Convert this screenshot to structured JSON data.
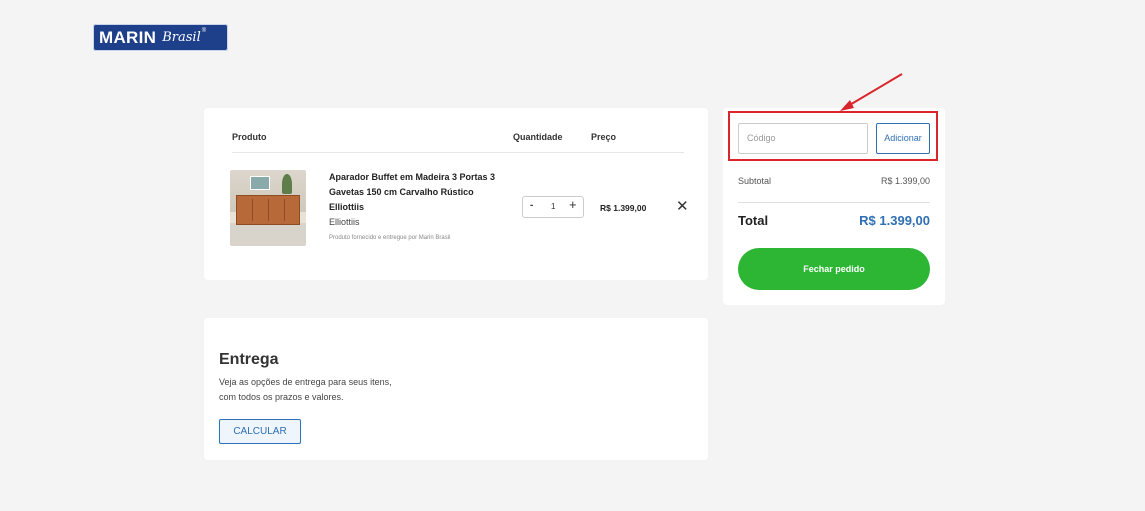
{
  "logo": {
    "brand": "MARIN",
    "script": "Brasil",
    "reg": "®"
  },
  "cart": {
    "headers": {
      "product": "Produto",
      "quantity": "Quantidade",
      "price": "Preço"
    },
    "item": {
      "name": "Aparador Buffet em Madeira 3 Portas 3 Gavetas 150 cm Carvalho Rústico Elliottiis",
      "brand": "Elliottiis",
      "note": "Produto fornecido e entregue por Marin Brasil",
      "minus": "-",
      "qty": "1",
      "plus": "+",
      "price": "R$ 1.399,00",
      "remove": "✕",
      "image_icon": "product-photo"
    }
  },
  "shipping": {
    "title": "Entrega",
    "desc_line1": "Veja as opções de entrega para seus itens,",
    "desc_line2": "com todos os prazos e valores.",
    "button": "CALCULAR"
  },
  "summary": {
    "coupon_placeholder": "Código",
    "coupon_button": "Adicionar",
    "subtotal_label": "Subtotal",
    "subtotal_value": "R$ 1.399,00",
    "total_label": "Total",
    "total_value": "R$ 1.399,00",
    "checkout": "Fechar pedido"
  },
  "colors": {
    "accent": "#2f6fb3",
    "checkout": "#2db634",
    "highlight": "#d9262b",
    "logo": "#1e3f8a"
  }
}
